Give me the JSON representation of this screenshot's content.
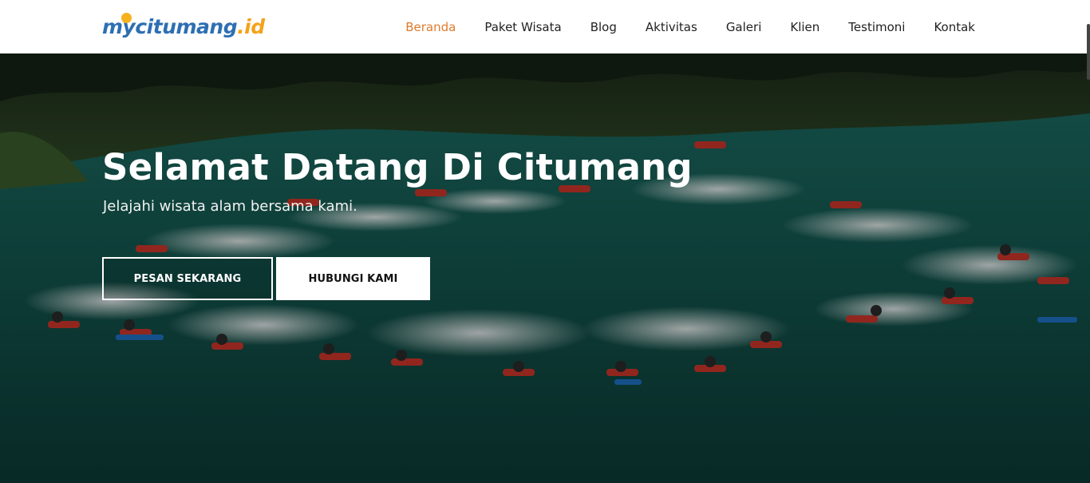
{
  "brand": {
    "logo_prefix": "my",
    "logo_main": "citumang",
    "logo_suffix": ".id",
    "primary_color": "#2d6fb3",
    "accent_color": "#f3a31a"
  },
  "nav": {
    "items": [
      {
        "label": "Beranda",
        "active": true
      },
      {
        "label": "Paket Wisata",
        "active": false
      },
      {
        "label": "Blog",
        "active": false
      },
      {
        "label": "Aktivitas",
        "active": false
      },
      {
        "label": "Galeri",
        "active": false
      },
      {
        "label": "Klien",
        "active": false
      },
      {
        "label": "Testimoni",
        "active": false
      },
      {
        "label": "Kontak",
        "active": false
      }
    ],
    "active_color": "#e07b2c"
  },
  "hero": {
    "title": "Selamat Datang Di Citumang",
    "subtitle": "Jelajahi wisata alam bersama kami.",
    "primary_button": "PESAN SEKARANG",
    "secondary_button": "HUBUNGI KAMI"
  }
}
